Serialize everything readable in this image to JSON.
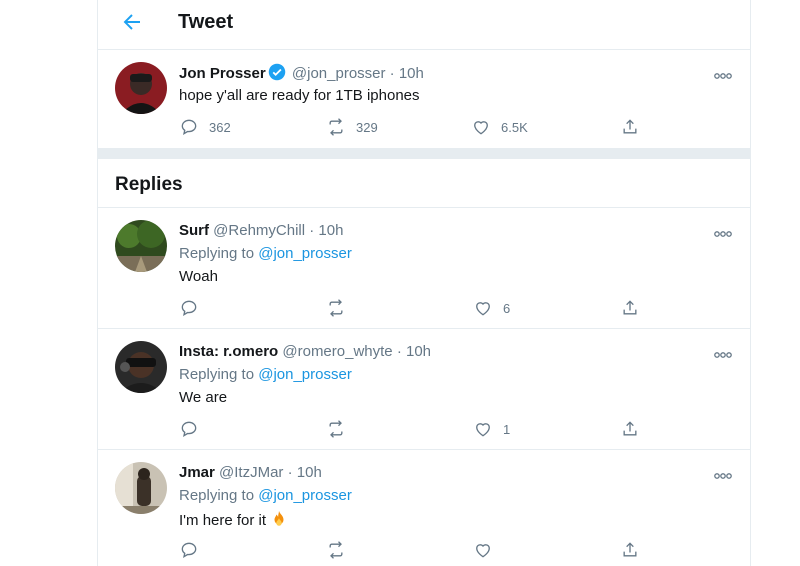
{
  "header": {
    "title": "Tweet"
  },
  "main_tweet": {
    "name": "Jon Prosser",
    "handle": "@jon_prosser",
    "time": "· 10h",
    "text": "hope y'all are ready for 1TB iphones",
    "replies": "362",
    "retweets": "329",
    "likes": "6.5K"
  },
  "replies_section": {
    "title": "Replies"
  },
  "replies": [
    {
      "name": "Surf",
      "handle": "@RehmyChill",
      "time": "· 10h",
      "replying_prefix": "Replying to",
      "replying_handle": "@jon_prosser",
      "text": "Woah",
      "likes": "6"
    },
    {
      "name": "Insta: r.omero",
      "handle": "@romero_whyte",
      "time": "· 10h",
      "replying_prefix": "Replying to",
      "replying_handle": "@jon_prosser",
      "text": "We are",
      "likes": "1"
    },
    {
      "name": "Jmar",
      "handle": "@ItzJMar",
      "time": "· 10h",
      "replying_prefix": "Replying to",
      "replying_handle": "@jon_prosser",
      "text": "I'm here for it",
      "emoji_icon": "fire-emoji-icon",
      "likes": ""
    }
  ],
  "colors": {
    "accent": "#1da1f2",
    "link": "#1b95e0",
    "secondary_text": "#657786",
    "border": "#e6ecf0"
  }
}
